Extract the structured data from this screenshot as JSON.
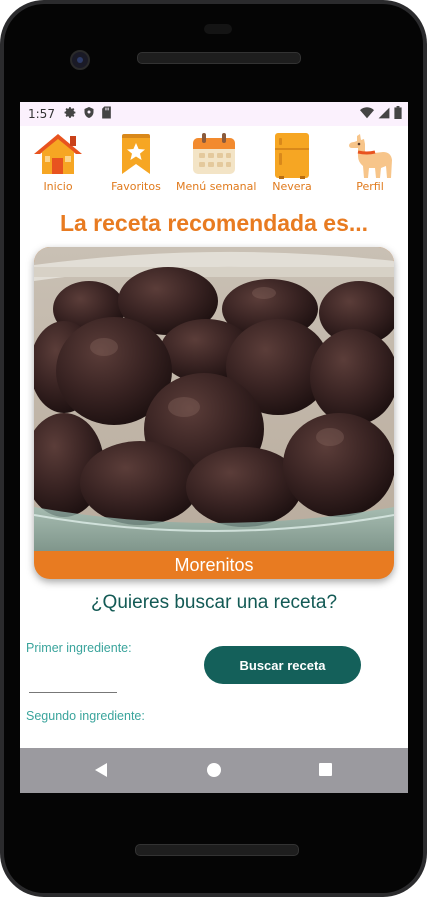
{
  "status_bar": {
    "time": "1:57",
    "left_icons": [
      "gear-icon",
      "shield-icon",
      "sd-card-icon"
    ],
    "right_icons": [
      "wifi-icon",
      "cell-signal-icon",
      "battery-icon"
    ]
  },
  "nav": {
    "items": [
      {
        "label": "Inicio",
        "icon": "house-icon"
      },
      {
        "label": "Favoritos",
        "icon": "bookmark-star-icon"
      },
      {
        "label": "Menú semanal",
        "icon": "calendar-icon"
      },
      {
        "label": "Nevera",
        "icon": "fridge-icon"
      },
      {
        "label": "Perfil",
        "icon": "llama-icon"
      }
    ],
    "accent_color": "#e07a1c"
  },
  "headline": "La receta recomendada es...",
  "recommended_recipe": {
    "name": "Morenitos",
    "image": "chocolate-covered-sweets-photo"
  },
  "search": {
    "question": "¿Quieres buscar una receta?",
    "first_ingredient_label": "Primer ingrediente:",
    "first_ingredient_value": "",
    "second_ingredient_label": "Segundo ingrediente:",
    "button_label": "Buscar receta",
    "button_color": "#14605a"
  },
  "system_nav": {
    "buttons": [
      "back-icon",
      "home-icon",
      "recents-icon"
    ]
  }
}
